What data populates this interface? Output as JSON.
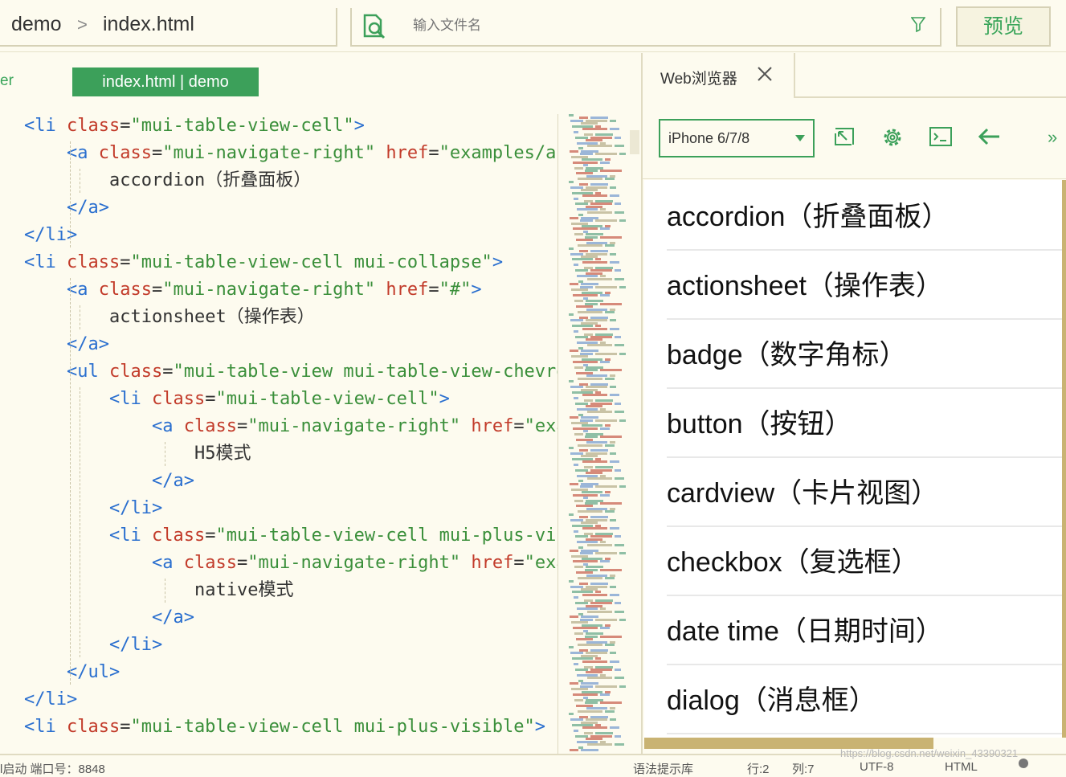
{
  "breadcrumb": {
    "project": "demo",
    "separator": ">",
    "file": "index.html"
  },
  "search": {
    "placeholder": "输入文件名"
  },
  "toolbar": {
    "preview_label": "预览"
  },
  "editor": {
    "side_label": "er",
    "tab_label": "index.html | demo"
  },
  "code_lines": [
    [
      [
        "tag",
        "<li "
      ],
      [
        "attr",
        "class"
      ],
      [
        "txt",
        "="
      ],
      [
        "str",
        "\"mui-table-view-cell\""
      ],
      [
        "tag",
        ">"
      ]
    ],
    [
      [
        "tag",
        "<a "
      ],
      [
        "attr",
        "class"
      ],
      [
        "txt",
        "="
      ],
      [
        "str",
        "\"mui-navigate-right\""
      ],
      [
        "txt",
        " "
      ],
      [
        "attr",
        "href"
      ],
      [
        "txt",
        "="
      ],
      [
        "str",
        "\"examples/ac"
      ]
    ],
    [
      [
        "txt",
        "accordion（折叠面板）"
      ]
    ],
    [
      [
        "tag",
        "</a>"
      ]
    ],
    [
      [
        "tag",
        "</li>"
      ]
    ],
    [
      [
        "tag",
        "<li "
      ],
      [
        "attr",
        "class"
      ],
      [
        "txt",
        "="
      ],
      [
        "str",
        "\"mui-table-view-cell mui-collapse\""
      ],
      [
        "tag",
        ">"
      ]
    ],
    [
      [
        "tag",
        "<a "
      ],
      [
        "attr",
        "class"
      ],
      [
        "txt",
        "="
      ],
      [
        "str",
        "\"mui-navigate-right\""
      ],
      [
        "txt",
        " "
      ],
      [
        "attr",
        "href"
      ],
      [
        "txt",
        "="
      ],
      [
        "str",
        "\"#\""
      ],
      [
        "tag",
        ">"
      ]
    ],
    [
      [
        "txt",
        "actionsheet（操作表）"
      ]
    ],
    [
      [
        "tag",
        "</a>"
      ]
    ],
    [
      [
        "tag",
        "<ul "
      ],
      [
        "attr",
        "class"
      ],
      [
        "txt",
        "="
      ],
      [
        "str",
        "\"mui-table-view mui-table-view-chevro"
      ]
    ],
    [
      [
        "tag",
        "<li "
      ],
      [
        "attr",
        "class"
      ],
      [
        "txt",
        "="
      ],
      [
        "str",
        "\"mui-table-view-cell\""
      ],
      [
        "tag",
        ">"
      ]
    ],
    [
      [
        "tag",
        "<a "
      ],
      [
        "attr",
        "class"
      ],
      [
        "txt",
        "="
      ],
      [
        "str",
        "\"mui-navigate-right\""
      ],
      [
        "txt",
        " "
      ],
      [
        "attr",
        "href"
      ],
      [
        "txt",
        "="
      ],
      [
        "str",
        "\"exa"
      ]
    ],
    [
      [
        "txt",
        "H5模式"
      ]
    ],
    [
      [
        "tag",
        "</a>"
      ]
    ],
    [
      [
        "tag",
        "</li>"
      ]
    ],
    [
      [
        "tag",
        "<li "
      ],
      [
        "attr",
        "class"
      ],
      [
        "txt",
        "="
      ],
      [
        "str",
        "\"mui-table-view-cell mui-plus-vis"
      ]
    ],
    [
      [
        "tag",
        "<a "
      ],
      [
        "attr",
        "class"
      ],
      [
        "txt",
        "="
      ],
      [
        "str",
        "\"mui-navigate-right\""
      ],
      [
        "txt",
        " "
      ],
      [
        "attr",
        "href"
      ],
      [
        "txt",
        "="
      ],
      [
        "str",
        "\"exa"
      ]
    ],
    [
      [
        "txt",
        "native模式"
      ]
    ],
    [
      [
        "tag",
        "</a>"
      ]
    ],
    [
      [
        "tag",
        "</li>"
      ]
    ],
    [
      [
        "tag",
        "</ul>"
      ]
    ],
    [
      [
        "tag",
        "</li>"
      ]
    ],
    [
      [
        "tag",
        "<li "
      ],
      [
        "attr",
        "class"
      ],
      [
        "txt",
        "="
      ],
      [
        "str",
        "\"mui-table-view-cell mui-plus-visible\""
      ],
      [
        "tag",
        ">"
      ]
    ]
  ],
  "browser": {
    "tab_label": "Web浏览器",
    "device": "iPhone 6/7/8",
    "more": "»",
    "items": [
      "accordion（折叠面板）",
      "actionsheet（操作表）",
      "badge（数字角标）",
      "button（按钮）",
      "cardview（卡片视图）",
      "checkbox（复选框）",
      "date time（日期时间）",
      "dialog（消息框）"
    ]
  },
  "status": {
    "left": "l启动 端口号：8848",
    "hint": "语法提示库",
    "row": "行:2",
    "col": "列:7",
    "encoding": "UTF-8",
    "lang": "HTML"
  },
  "watermark": "https://blog.csdn.net/weixin_43390321",
  "colors": {
    "accent": "#3ca05a",
    "tag": "#2a6fcf",
    "attr": "#c23b2a",
    "string": "#3a8f3a",
    "background": "#fdfbef"
  }
}
